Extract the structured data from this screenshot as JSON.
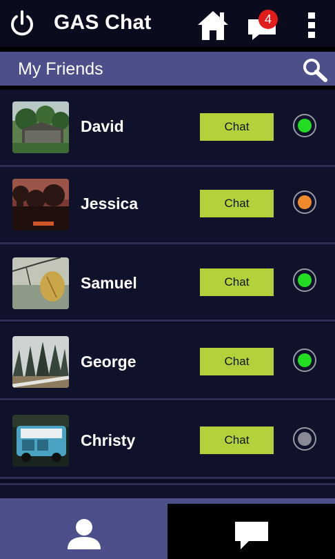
{
  "header": {
    "app_title": "GAS Chat",
    "notification_count": "4",
    "icons": [
      "power-icon",
      "home-icon",
      "chat-bubble-icon",
      "more-vertical-icon"
    ]
  },
  "subheader": {
    "title": "My Friends",
    "icon": "search-icon"
  },
  "friends": [
    {
      "name": "David",
      "button": "Chat",
      "status": "online",
      "status_color": "#22dd22"
    },
    {
      "name": "Jessica",
      "button": "Chat",
      "status": "away",
      "status_color": "#f08a2a"
    },
    {
      "name": "Samuel",
      "button": "Chat",
      "status": "online",
      "status_color": "#22dd22"
    },
    {
      "name": "George",
      "button": "Chat",
      "status": "online",
      "status_color": "#22dd22"
    },
    {
      "name": "Christy",
      "button": "Chat",
      "status": "offline",
      "status_color": "#8a8a96"
    }
  ],
  "tabs": [
    {
      "icon": "person-icon",
      "active": true
    },
    {
      "icon": "chat-bubble-icon",
      "active": false
    }
  ],
  "colors": {
    "background": "#10112b",
    "accent": "#4c4f8a",
    "chat_button": "#b3d13a"
  }
}
